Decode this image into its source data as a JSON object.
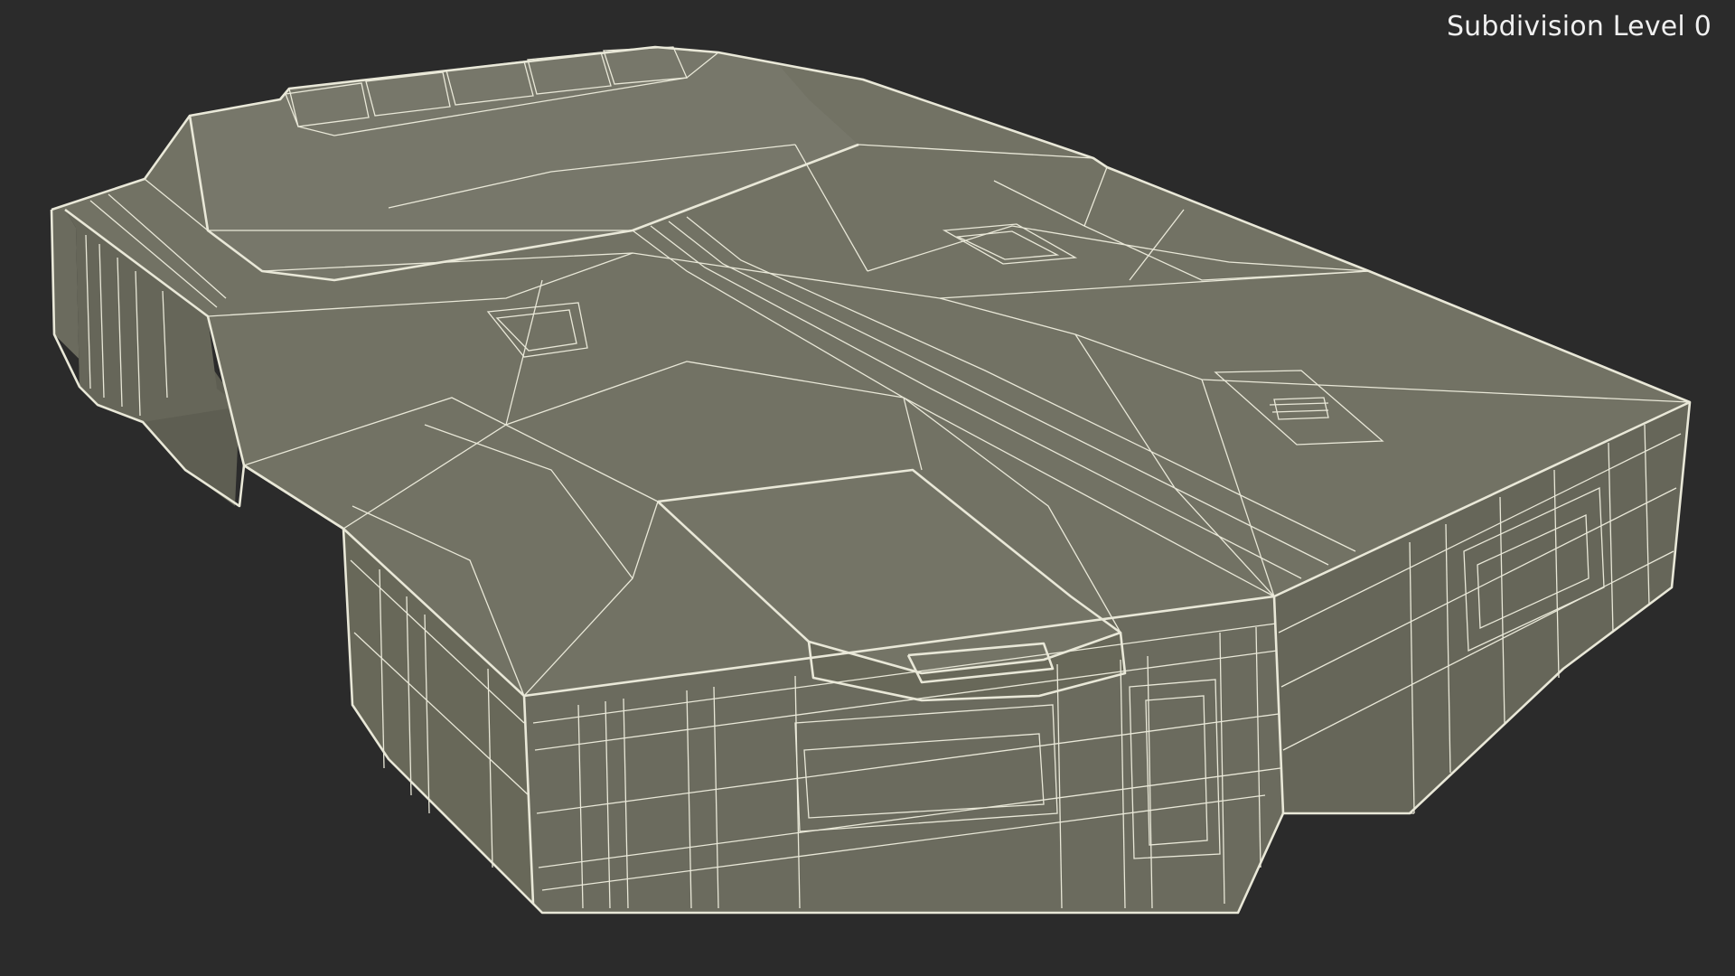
{
  "viewport": {
    "overlay_label": "Subdivision Level 0",
    "background_color": "#2b2b2b",
    "label_color": "#f0f0f0"
  },
  "model": {
    "display_mode": "wireframe-on-shaded",
    "surface_colors": {
      "top": "#727264",
      "front": "#6b6b5e",
      "side": "#676759",
      "shadow": "#5e5e52"
    },
    "wire_color": "#e9e8d8"
  }
}
